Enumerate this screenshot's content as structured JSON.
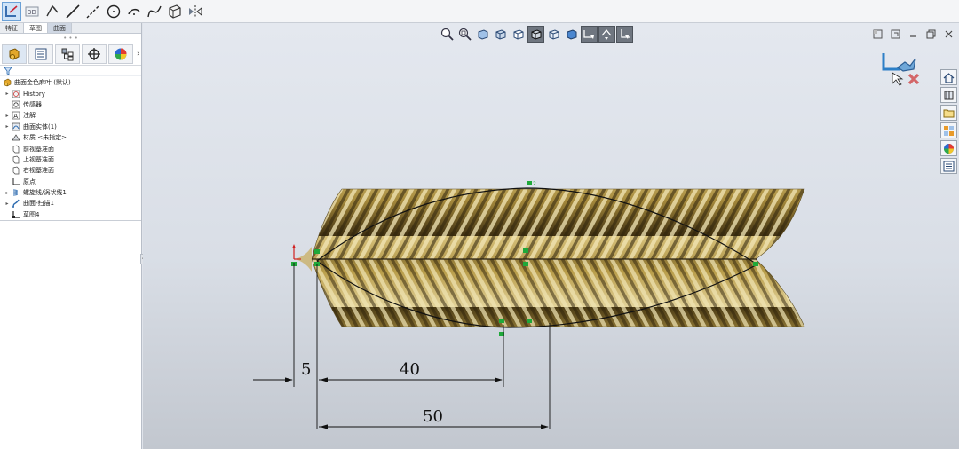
{
  "toolbar": {
    "items": [
      {
        "name": "sketch-icon"
      },
      {
        "name": "3d-sketch-icon",
        "label": "3D"
      },
      {
        "name": "smart-dimension-icon"
      },
      {
        "name": "line-icon"
      },
      {
        "name": "centerline-icon"
      },
      {
        "name": "circle-icon"
      },
      {
        "name": "arc-icon"
      },
      {
        "name": "spline-icon"
      },
      {
        "name": "plane-icon"
      },
      {
        "name": "mirror-icon"
      }
    ]
  },
  "left_panel": {
    "tabs": [
      "特征",
      "草图",
      "曲面"
    ],
    "active_tab": "草图",
    "filter_icon": "filter-icon",
    "manager_tabs": [
      "feature-manager-icon",
      "property-manager-icon",
      "configuration-manager-icon",
      "dimxpert-icon",
      "display-manager-icon"
    ],
    "tree": [
      {
        "label": "曲面金色麻叶 (默认)",
        "icon": "part-icon",
        "expander": "",
        "level": 0
      },
      {
        "label": "History",
        "icon": "history-icon",
        "expander": "▸",
        "level": 1
      },
      {
        "label": "传感器",
        "icon": "sensor-icon",
        "expander": "",
        "level": 1
      },
      {
        "label": "注解",
        "icon": "annotation-icon",
        "expander": "▸",
        "level": 1
      },
      {
        "label": "曲面实体(1)",
        "icon": "surface-body-icon",
        "expander": "▸",
        "level": 1
      },
      {
        "label": "材质 <未指定>",
        "icon": "material-icon",
        "expander": "",
        "level": 1
      },
      {
        "label": "前视基准面",
        "icon": "plane-icon",
        "expander": "",
        "level": 1
      },
      {
        "label": "上视基准面",
        "icon": "plane-icon",
        "expander": "",
        "level": 1
      },
      {
        "label": "右视基准面",
        "icon": "plane-icon",
        "expander": "",
        "level": 1
      },
      {
        "label": "原点",
        "icon": "origin-icon",
        "expander": "",
        "level": 1
      },
      {
        "label": "螺旋线/涡状线1",
        "icon": "helix-icon",
        "expander": "▸",
        "level": 1
      },
      {
        "label": "曲面-扫描1",
        "icon": "sweep-icon",
        "expander": "▸",
        "level": 1
      },
      {
        "label": "草图4",
        "icon": "sketch-icon",
        "expander": "",
        "level": 1
      }
    ]
  },
  "viewport": {
    "view_toolbar": [
      "zoom-to-fit-icon",
      "zoom-area-icon",
      "previous-view-icon",
      "section-view-icon",
      "view-orientation-icon",
      "display-style-icon",
      "hide-show-icon",
      "edit-appearance-icon",
      "scene-icon",
      "view-settings-icon",
      "normal-to-icon",
      "display-pane-icon"
    ],
    "window_controls": [
      "tile-icon",
      "tile-vertical-icon",
      "minimize-icon",
      "restore-icon",
      "close-icon"
    ],
    "task_pane": [
      "home-icon",
      "design-library-icon",
      "file-explorer-icon",
      "view-palette-icon",
      "appearances-icon",
      "custom-properties-icon"
    ],
    "dimensions": [
      "5",
      "40",
      "50"
    ],
    "colors": {
      "gold_light": "#e8d9a2",
      "gold_dark": "#4a3a14",
      "sketch_line": "#111111",
      "relation_green": "#1fa83a",
      "accept_blue": "#2d7fc7",
      "reject_red": "#cf3c3c"
    }
  }
}
